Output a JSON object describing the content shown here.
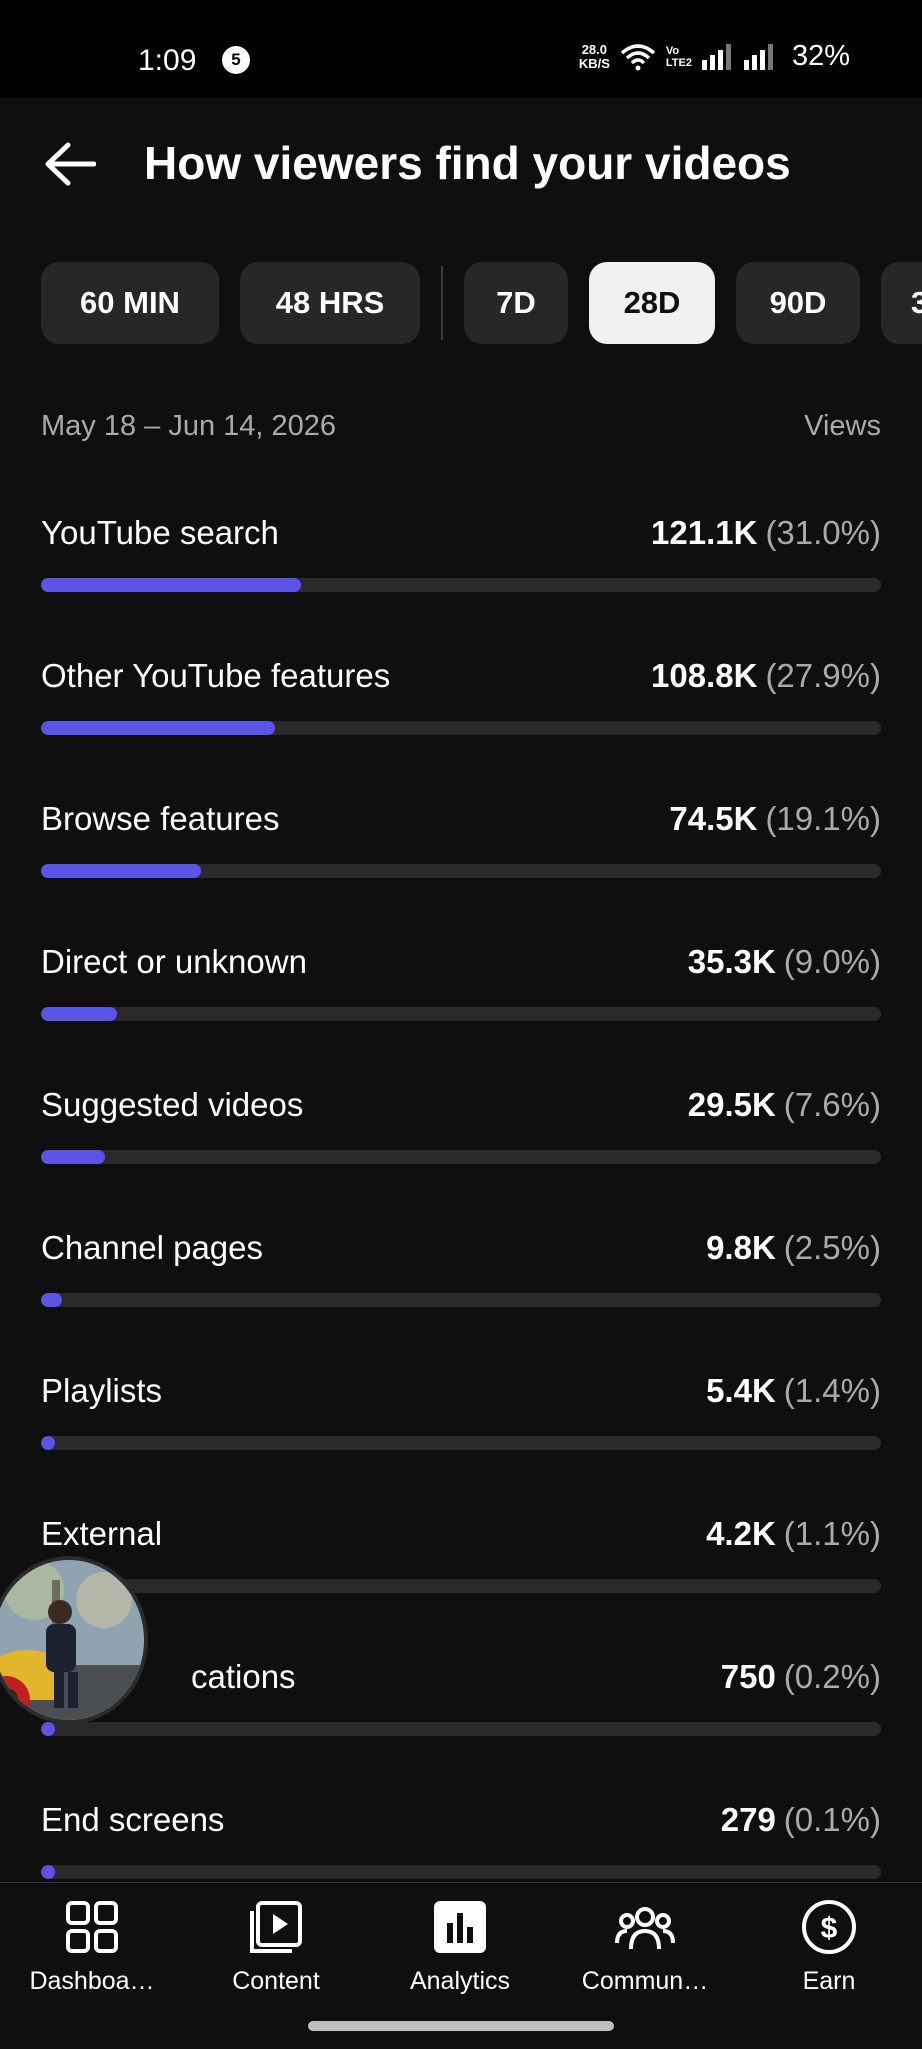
{
  "status_bar": {
    "time": "1:09",
    "notification_count": "5",
    "speed_value": "28.0",
    "speed_unit": "KB/S",
    "volte_top": "Vo",
    "volte_bottom": "LTE2",
    "battery": "32%"
  },
  "header": {
    "title": "How viewers find your videos",
    "back_icon": "arrow-left-icon"
  },
  "time_ranges": {
    "chips": [
      {
        "label": "60 MIN",
        "selected": false
      },
      {
        "label": "48 HRS",
        "selected": false
      },
      {
        "label": "7D",
        "selected": false
      },
      {
        "label": "28D",
        "selected": true
      },
      {
        "label": "90D",
        "selected": false
      },
      {
        "label": "3",
        "selected": false
      }
    ]
  },
  "report": {
    "date_range": "May 18 – Jun 14, 2026",
    "metric": "Views",
    "accent_color": "#5b54e6",
    "sources": [
      {
        "label": "YouTube search",
        "value": "121.1K",
        "percent": "(31.0%)",
        "fraction": 0.31
      },
      {
        "label": "Other YouTube features",
        "value": "108.8K",
        "percent": "(27.9%)",
        "fraction": 0.279
      },
      {
        "label": "Browse features",
        "value": "74.5K",
        "percent": "(19.1%)",
        "fraction": 0.191
      },
      {
        "label": "Direct or unknown",
        "value": "35.3K",
        "percent": "(9.0%)",
        "fraction": 0.09
      },
      {
        "label": "Suggested videos",
        "value": "29.5K",
        "percent": "(7.6%)",
        "fraction": 0.076
      },
      {
        "label": "Channel pages",
        "value": "9.8K",
        "percent": "(2.5%)",
        "fraction": 0.025
      },
      {
        "label": "Playlists",
        "value": "5.4K",
        "percent": "(1.4%)",
        "fraction": 0.014
      },
      {
        "label": "External",
        "value": "4.2K",
        "percent": "(1.1%)",
        "fraction": 0.011
      },
      {
        "label": "cations",
        "value": "750",
        "percent": "(0.2%)",
        "fraction": 0.002
      },
      {
        "label": "End screens",
        "value": "279",
        "percent": "(0.1%)",
        "fraction": 0.001
      }
    ]
  },
  "bottom_nav": {
    "items": [
      {
        "label": "Dashboa…",
        "icon": "dashboard-icon",
        "active": false
      },
      {
        "label": "Content",
        "icon": "content-icon",
        "active": false
      },
      {
        "label": "Analytics",
        "icon": "analytics-icon",
        "active": true
      },
      {
        "label": "Commun…",
        "icon": "community-icon",
        "active": false
      },
      {
        "label": "Earn",
        "icon": "earn-icon",
        "active": false
      }
    ]
  }
}
